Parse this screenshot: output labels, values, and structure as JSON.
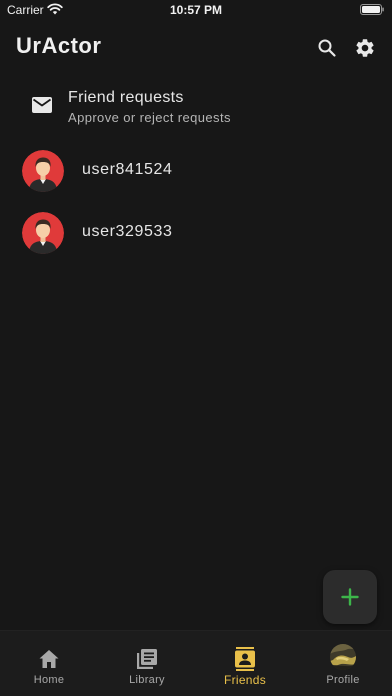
{
  "status_bar": {
    "carrier": "Carrier",
    "time": "10:57 PM"
  },
  "header": {
    "title": "UrActor"
  },
  "friend_requests": {
    "title": "Friend requests",
    "subtitle": "Approve or reject requests"
  },
  "friends": [
    {
      "username": "user841524"
    },
    {
      "username": "user329533"
    }
  ],
  "colors": {
    "accent": "#e9c04a",
    "fab_plus": "#3db54a",
    "avatar_bg": "#e03a3a",
    "background": "#171717"
  },
  "bottom_nav": [
    {
      "label": "Home",
      "icon": "home-icon",
      "active": false
    },
    {
      "label": "Library",
      "icon": "library-icon",
      "active": false
    },
    {
      "label": "Friends",
      "icon": "friends-icon",
      "active": true
    },
    {
      "label": "Profile",
      "icon": "profile-avatar",
      "active": false
    }
  ]
}
